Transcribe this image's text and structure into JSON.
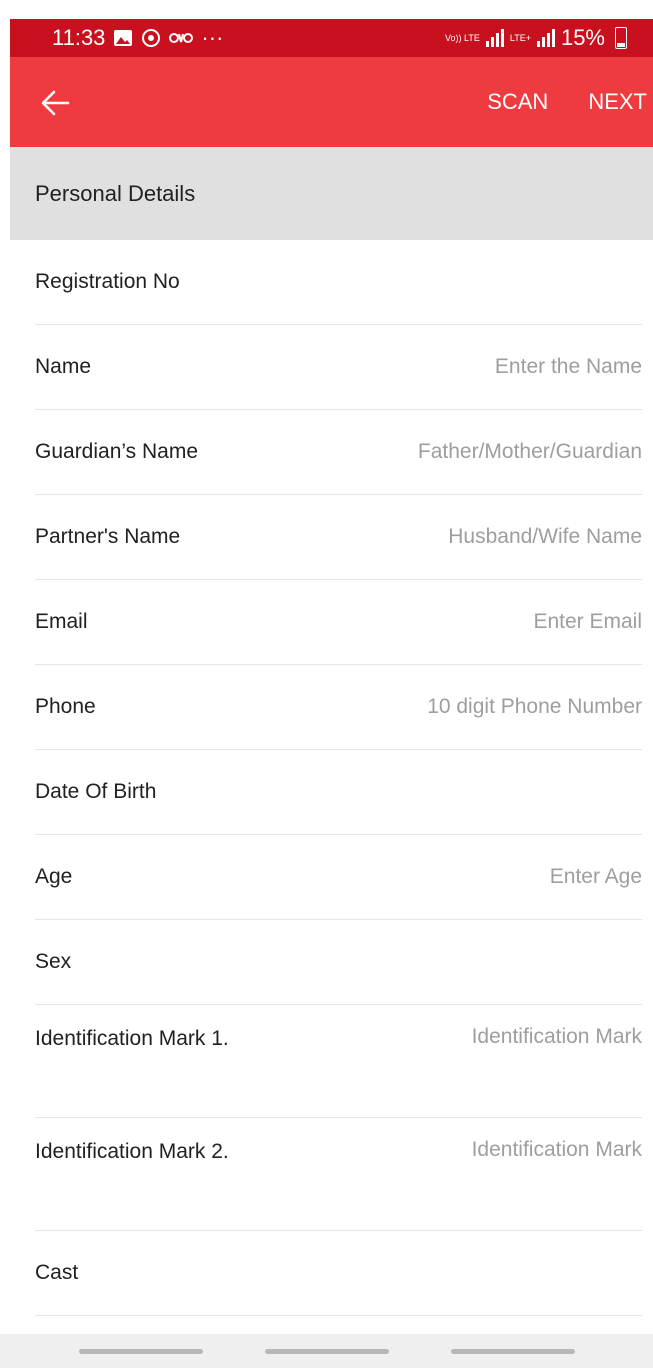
{
  "status_bar": {
    "time": "11:33",
    "more": "···",
    "network_1": "Vo)) LTE",
    "network_2": "LTE+",
    "battery": "15%"
  },
  "toolbar": {
    "scan_label": "SCAN",
    "next_label": "NEXT"
  },
  "section": {
    "title": "Personal Details"
  },
  "fields": {
    "registration_no": {
      "label": "Registration No",
      "placeholder": ""
    },
    "name": {
      "label": "Name",
      "placeholder": "Enter the Name"
    },
    "guardian_name": {
      "label": "Guardian’s Name",
      "placeholder": "Father/Mother/Guardian"
    },
    "partner_name": {
      "label": "Partner's Name",
      "placeholder": "Husband/Wife Name"
    },
    "email": {
      "label": "Email",
      "placeholder": "Enter Email"
    },
    "phone": {
      "label": "Phone",
      "placeholder": "10 digit Phone Number"
    },
    "dob": {
      "label": "Date Of Birth",
      "placeholder": ""
    },
    "age": {
      "label": "Age",
      "placeholder": "Enter Age"
    },
    "sex": {
      "label": "Sex",
      "placeholder": ""
    },
    "id_mark_1": {
      "label": "Identification Mark 1.",
      "placeholder": "Identification Mark"
    },
    "id_mark_2": {
      "label": "Identification Mark 2.",
      "placeholder": "Identification Mark"
    },
    "cast": {
      "label": "Cast",
      "placeholder": ""
    }
  },
  "colors": {
    "status_bar": "#c8101f",
    "toolbar": "#ef3b40",
    "section_header": "#e0e0e0"
  }
}
